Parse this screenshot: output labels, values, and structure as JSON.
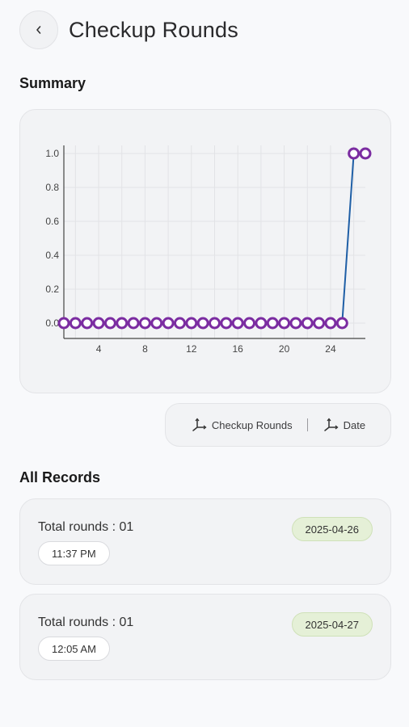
{
  "header": {
    "title": "Checkup Rounds"
  },
  "summary": {
    "title": "Summary"
  },
  "chart_data": {
    "type": "line",
    "x": [
      1,
      2,
      3,
      4,
      5,
      6,
      7,
      8,
      9,
      10,
      11,
      12,
      13,
      14,
      15,
      16,
      17,
      18,
      19,
      20,
      21,
      22,
      23,
      24,
      25,
      26,
      27
    ],
    "series": [
      {
        "values": [
          0,
          0,
          0,
          0,
          0,
          0,
          0,
          0,
          0,
          0,
          0,
          0,
          0,
          0,
          0,
          0,
          0,
          0,
          0,
          0,
          0,
          0,
          0,
          0,
          0,
          1,
          1
        ]
      }
    ],
    "x_ticks": [
      "4",
      "8",
      "12",
      "16",
      "20",
      "24"
    ],
    "y_ticks": [
      "0.0",
      "0.2",
      "0.4",
      "0.6",
      "0.8",
      "1.0"
    ],
    "ylim": [
      0,
      1
    ],
    "grid": true,
    "line_color": "#1f5fa6",
    "marker_color": "#7b2ca1"
  },
  "legend": {
    "item1": "Checkup Rounds",
    "item2": "Date"
  },
  "records_title": "All Records",
  "records": [
    {
      "rounds": "Total rounds : 01",
      "time": "11:37 PM",
      "date": "2025-04-26"
    },
    {
      "rounds": "Total rounds : 01",
      "time": "12:05 AM",
      "date": "2025-04-27"
    }
  ]
}
